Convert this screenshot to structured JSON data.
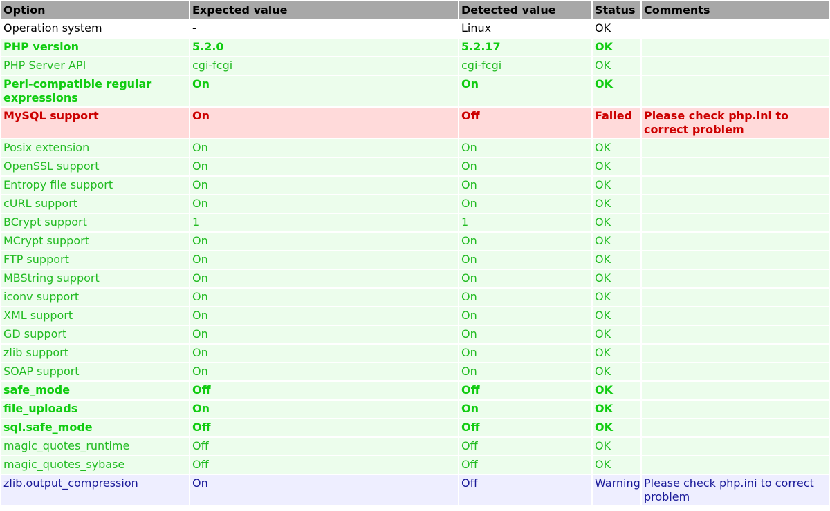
{
  "headers": {
    "option": "Option",
    "expected": "Expected value",
    "detected": "Detected value",
    "status": "Status",
    "comments": "Comments"
  },
  "colors": {
    "header_bg": "#a8a8a8",
    "ok_bg": "#ecfdec",
    "ok_text": "#22bb22",
    "fail_bg": "#ffdada",
    "fail_text": "#cc0000",
    "warn_bg": "#eeeeff",
    "warn_text": "#1a1a99"
  },
  "rows": [
    {
      "option": "Operation system",
      "expected": "-",
      "detected": "Linux",
      "status": "OK",
      "comments": ""
    },
    {
      "option": "PHP version",
      "expected": "5.2.0",
      "detected": "5.2.17",
      "status": "OK",
      "comments": ""
    },
    {
      "option": "PHP Server API",
      "expected": "cgi-fcgi",
      "detected": "cgi-fcgi",
      "status": "OK",
      "comments": ""
    },
    {
      "option": "Perl-compatible regular expressions",
      "expected": "On",
      "detected": "On",
      "status": "OK",
      "comments": ""
    },
    {
      "option": "MySQL support",
      "expected": "On",
      "detected": "Off",
      "status": "Failed",
      "comments": "Please check php.ini to correct problem"
    },
    {
      "option": "Posix extension",
      "expected": "On",
      "detected": "On",
      "status": "OK",
      "comments": ""
    },
    {
      "option": "OpenSSL support",
      "expected": "On",
      "detected": "On",
      "status": "OK",
      "comments": ""
    },
    {
      "option": "Entropy file support",
      "expected": "On",
      "detected": "On",
      "status": "OK",
      "comments": ""
    },
    {
      "option": "cURL support",
      "expected": "On",
      "detected": "On",
      "status": "OK",
      "comments": ""
    },
    {
      "option": "BCrypt support",
      "expected": "1",
      "detected": "1",
      "status": "OK",
      "comments": ""
    },
    {
      "option": "MCrypt support",
      "expected": "On",
      "detected": "On",
      "status": "OK",
      "comments": ""
    },
    {
      "option": "FTP support",
      "expected": "On",
      "detected": "On",
      "status": "OK",
      "comments": ""
    },
    {
      "option": "MBString support",
      "expected": "On",
      "detected": "On",
      "status": "OK",
      "comments": ""
    },
    {
      "option": "iconv support",
      "expected": "On",
      "detected": "On",
      "status": "OK",
      "comments": ""
    },
    {
      "option": "XML support",
      "expected": "On",
      "detected": "On",
      "status": "OK",
      "comments": ""
    },
    {
      "option": "GD support",
      "expected": "On",
      "detected": "On",
      "status": "OK",
      "comments": ""
    },
    {
      "option": "zlib support",
      "expected": "On",
      "detected": "On",
      "status": "OK",
      "comments": ""
    },
    {
      "option": "SOAP support",
      "expected": "On",
      "detected": "On",
      "status": "OK",
      "comments": ""
    },
    {
      "option": "safe_mode",
      "expected": "Off",
      "detected": "Off",
      "status": "OK",
      "comments": ""
    },
    {
      "option": "file_uploads",
      "expected": "On",
      "detected": "On",
      "status": "OK",
      "comments": ""
    },
    {
      "option": "sql.safe_mode",
      "expected": "Off",
      "detected": "Off",
      "status": "OK",
      "comments": ""
    },
    {
      "option": "magic_quotes_runtime",
      "expected": "Off",
      "detected": "Off",
      "status": "OK",
      "comments": ""
    },
    {
      "option": "magic_quotes_sybase",
      "expected": "Off",
      "detected": "Off",
      "status": "OK",
      "comments": ""
    },
    {
      "option": "zlib.output_compression",
      "expected": "On",
      "detected": "Off",
      "status": "Warning",
      "comments": "Please check php.ini to correct problem"
    }
  ]
}
